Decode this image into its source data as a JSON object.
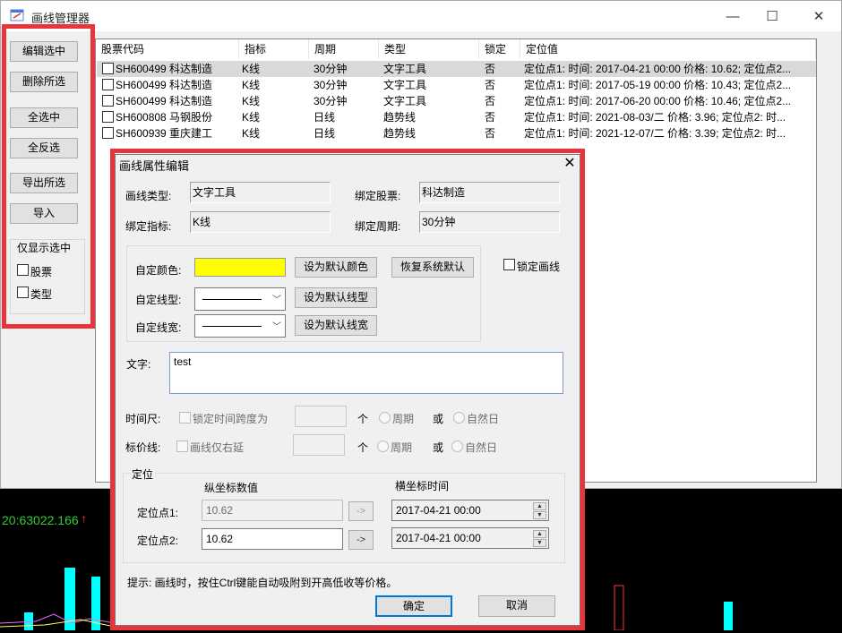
{
  "window": {
    "title": "画线管理器",
    "minimize_glyph": "—",
    "maximize_glyph": "☐",
    "close_glyph": "✕"
  },
  "left_panel": {
    "edit_selected": "编辑选中",
    "delete_selected": "删除所选",
    "select_all": "全选中",
    "invert_selection": "全反选",
    "export_selected": "导出所选",
    "import": "导入",
    "filter_group_title": "仅显示选中",
    "filter_stock": "股票",
    "filter_type": "类型"
  },
  "table": {
    "columns": [
      "股票代码",
      "指标",
      "周期",
      "类型",
      "锁定",
      "定位值"
    ],
    "rows": [
      {
        "code": "SH600499 科达制造",
        "indicator": "K线",
        "period": "30分钟",
        "type": "文字工具",
        "locked": "否",
        "position": "定位点1: 时间: 2017-04-21 00:00 价格: 10.62;  定位点2...",
        "selected": true
      },
      {
        "code": "SH600499 科达制造",
        "indicator": "K线",
        "period": "30分钟",
        "type": "文字工具",
        "locked": "否",
        "position": "定位点1: 时间: 2017-05-19 00:00 价格: 10.43;  定位点2...",
        "selected": false
      },
      {
        "code": "SH600499 科达制造",
        "indicator": "K线",
        "period": "30分钟",
        "type": "文字工具",
        "locked": "否",
        "position": "定位点1: 时间: 2017-06-20 00:00 价格: 10.46;  定位点2...",
        "selected": false
      },
      {
        "code": "SH600808 马钢股份",
        "indicator": "K线",
        "period": "日线",
        "type": "趋势线",
        "locked": "否",
        "position": "定位点1: 时间: 2021-08-03/二 价格: 3.96;  定位点2: 时...",
        "selected": false
      },
      {
        "code": "SH600939 重庆建工",
        "indicator": "K线",
        "period": "日线",
        "type": "趋势线",
        "locked": "否",
        "position": "定位点1: 时间: 2021-12-07/二 价格: 3.39;  定位点2: 时...",
        "selected": false
      }
    ]
  },
  "chart_bg": {
    "price_readout": "20:63022.166",
    "arrow": "↑"
  },
  "dialog": {
    "title": "画线属性编辑",
    "close_glyph": "✕",
    "line_type_label": "画线类型:",
    "line_type_value": "文字工具",
    "bound_stock_label": "绑定股票:",
    "bound_stock_value": "科达制造",
    "bound_indicator_label": "绑定指标:",
    "bound_indicator_value": "K线",
    "bound_period_label": "绑定周期:",
    "bound_period_value": "30分钟",
    "custom_color_label": "自定颜色:",
    "custom_color_value": "#ffff00",
    "set_default_color": "设为默认颜色",
    "restore_system_default": "恢复系统默认",
    "lock_line": "锁定画线",
    "custom_linestyle_label": "自定线型:",
    "set_default_linestyle": "设为默认线型",
    "custom_linewidth_label": "自定线宽:",
    "set_default_linewidth": "设为默认线宽",
    "text_label": "文字:",
    "text_value": "test",
    "time_ruler_label": "时间尺:",
    "lock_time_span": "锁定时间跨度为",
    "unit_ge": "个",
    "period": "周期",
    "or": "或",
    "natural_day": "自然日",
    "price_line_label": "标价线:",
    "line_extend_right": "画线仅右延",
    "position_group_title": "定位",
    "y_axis_header": "纵坐标数值",
    "x_axis_header": "横坐标时间",
    "point1_label": "定位点1:",
    "point1_value": "10.62",
    "point1_time": "2017-04-21 00:00",
    "point2_label": "定位点2:",
    "point2_value": "10.62",
    "point2_time": "2017-04-21 00:00",
    "arrow_button": "->",
    "hint": "提示:  画线时，按住Ctrl键能自动吸附到开高低收等价格。",
    "ok": "确定",
    "cancel": "取消"
  },
  "colors": {
    "highlight_red": "#e8343a",
    "yellow_swatch": "#ffff00",
    "chart_green": "#33cc33"
  }
}
